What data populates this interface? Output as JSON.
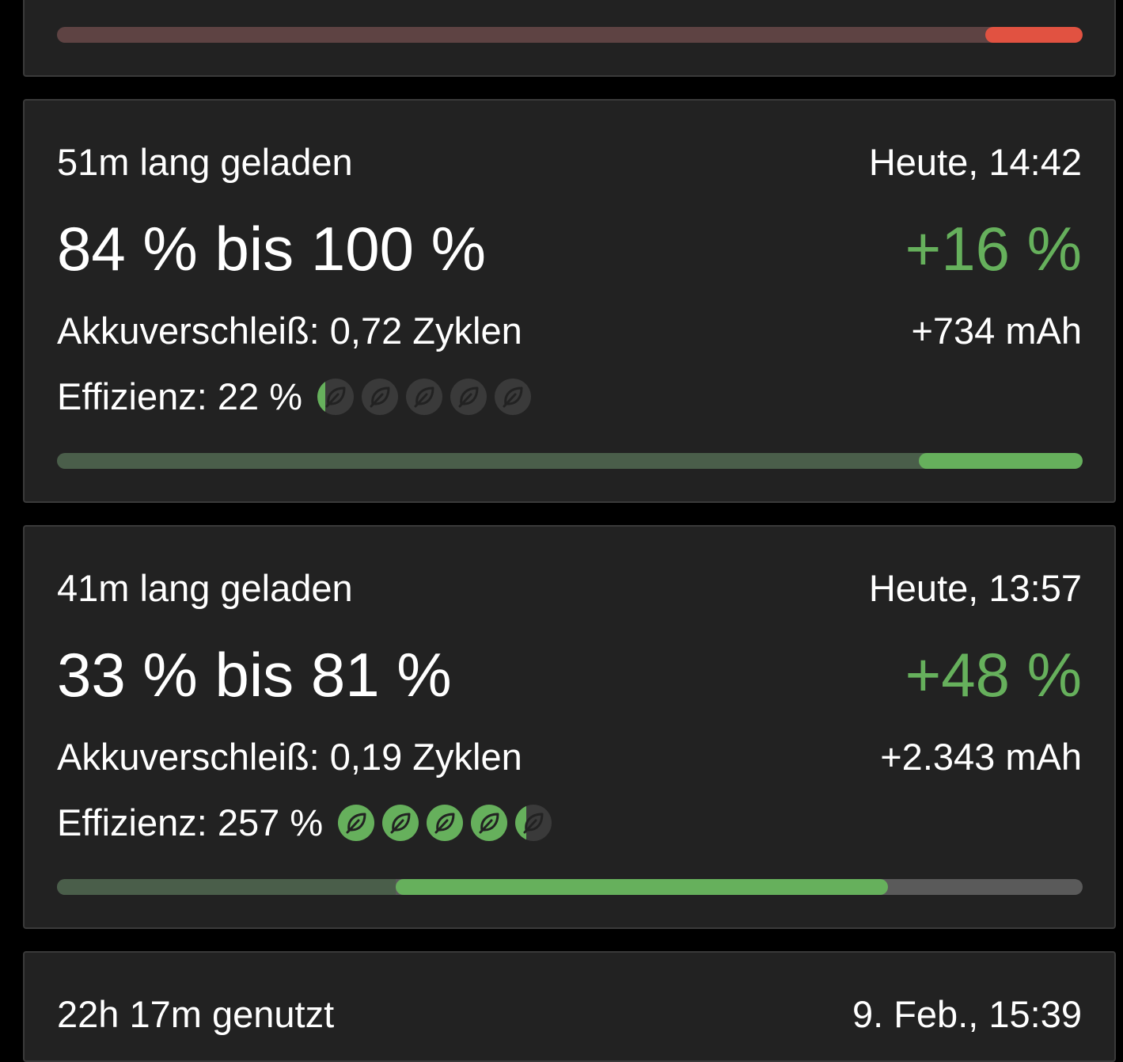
{
  "colors": {
    "background": "#000000",
    "card": "#222222",
    "green": "#66b05c",
    "green_dim": "#4a5e4a",
    "red": "#e15241",
    "red_dim": "#5e4343",
    "gray_track": "#5a5a5a",
    "leaf_off": "#3a3a3a"
  },
  "cards": [
    {
      "charge_range": {
        "start_fraction": 0.0,
        "end_fraction": 0.905,
        "highlight_start_fraction": 0.905,
        "highlight_end_fraction": 1.0
      },
      "status": "discharge"
    },
    {
      "duration": "51m lang geladen",
      "time": "Heute, 14:42",
      "range": "84 % bis 100 %",
      "delta": "+16 %",
      "wear": "Akkuverschleiß: 0,72 Zyklen",
      "capacity": "+734 mAh",
      "efficiency": "Effizienz: 22 %",
      "efficiency_leaves": 0.22,
      "leaf_icon": "leaf-icon",
      "charge_range": {
        "start_percent": 84,
        "end_percent": 100
      }
    },
    {
      "duration": "41m lang geladen",
      "time": "Heute, 13:57",
      "range": "33 % bis 81 %",
      "delta": "+48 %",
      "wear": "Akkuverschleiß: 0,19 Zyklen",
      "capacity": "+2.343 mAh",
      "efficiency": "Effizienz: 257 %",
      "efficiency_leaves": 4.3,
      "leaf_icon": "leaf-icon",
      "charge_range": {
        "start_percent": 33,
        "end_percent": 81
      }
    },
    {
      "duration": "22h 17m genutzt",
      "time": "9. Feb., 15:39"
    }
  ]
}
